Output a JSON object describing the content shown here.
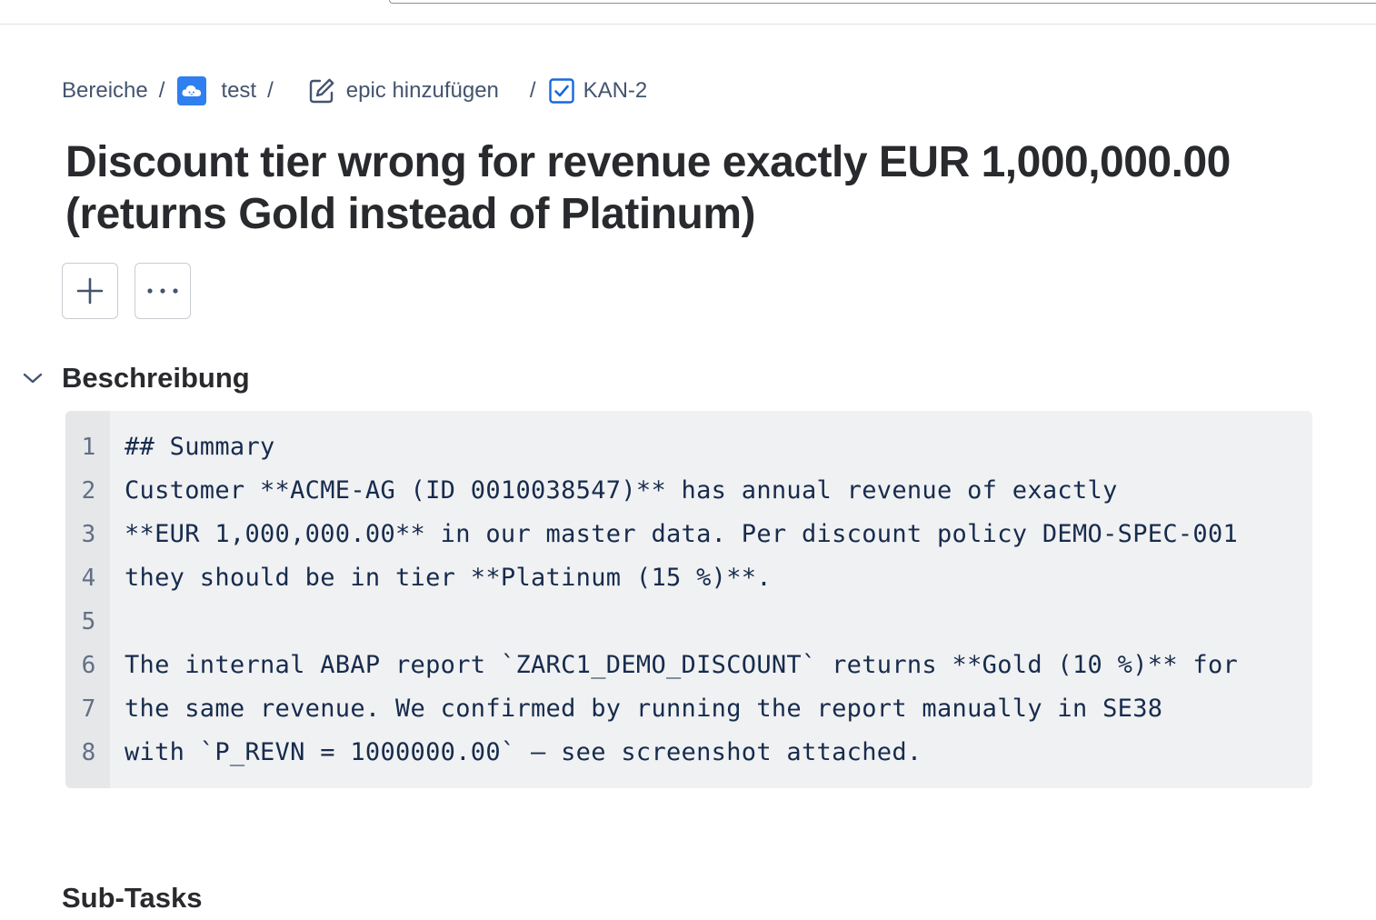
{
  "breadcrumb": {
    "root": "Bereiche",
    "project": "test",
    "epic": "epic hinzufügen",
    "issue_key": "KAN-2",
    "separator": "/"
  },
  "issue": {
    "title": "Discount tier wrong for revenue exactly EUR 1,000,000.00 (returns Gold instead of Platinum)"
  },
  "description": {
    "heading": "Beschreibung",
    "lines": [
      "## Summary",
      "Customer **ACME-AG (ID 0010038547)** has annual revenue of exactly",
      "**EUR 1,000,000.00** in our master data. Per discount policy DEMO-SPEC-001",
      "they should be in tier **Platinum (15 %)**.",
      "",
      "The internal ABAP report `ZARC1_DEMO_DISCOUNT` returns **Gold (10 %)** for",
      "the same revenue. We confirmed by running the report manually in SE38",
      "with `P_REVN = 1000000.00` — see screenshot attached."
    ],
    "line_numbers": [
      "1",
      "2",
      "3",
      "4",
      "5",
      "6",
      "7",
      "8"
    ]
  },
  "subtasks": {
    "heading": "Sub-Tasks"
  },
  "icons": {
    "project": "cloud-project-icon",
    "epic": "edit-icon",
    "issue_type": "checkbox-task-icon",
    "add": "plus-icon",
    "more": "ellipsis-icon",
    "collapse": "chevron-down-icon"
  },
  "colors": {
    "project_icon": "#2f7ff0",
    "task_icon": "#1868db",
    "code_background": "#f0f1f2"
  }
}
